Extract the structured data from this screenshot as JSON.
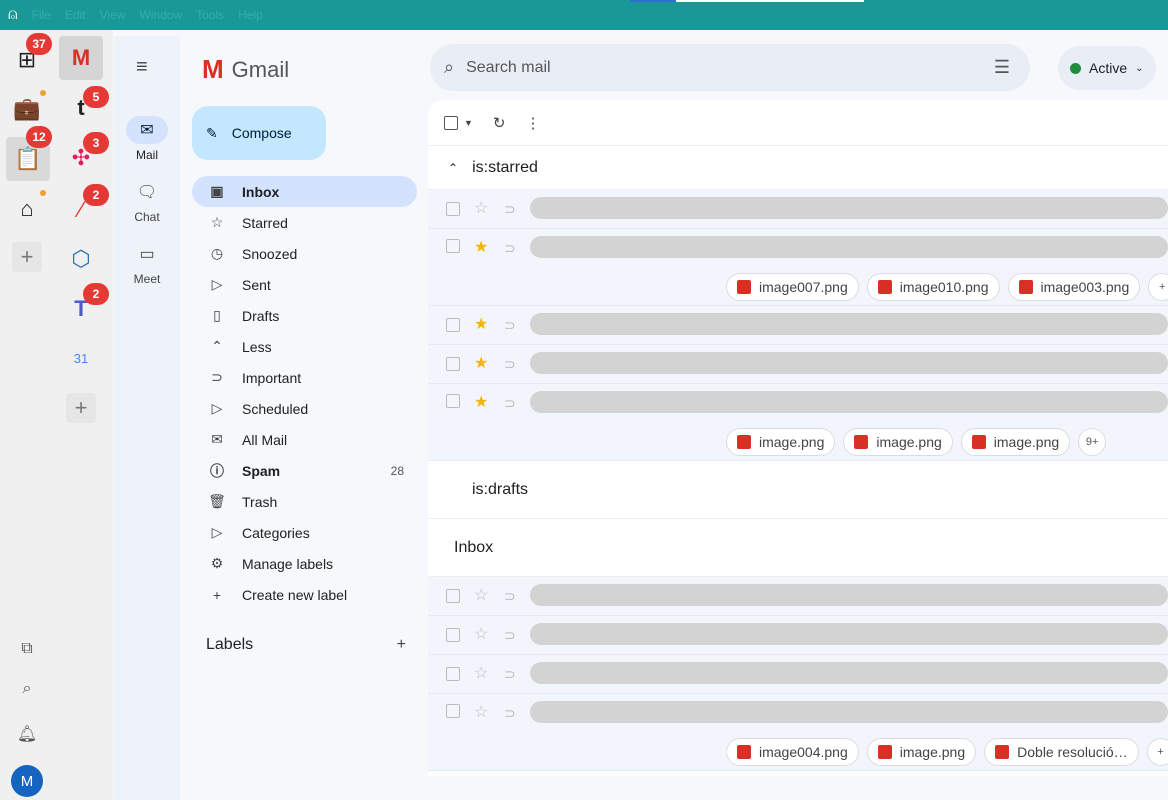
{
  "menubar": {
    "items": [
      "File",
      "Edit",
      "View",
      "Window",
      "Tools",
      "Help"
    ]
  },
  "rail": {
    "badges": {
      "dashboard": "37",
      "tasks": "12",
      "tape": "5",
      "slack": "3",
      "asana": "2",
      "teams": "2"
    },
    "calendar_day": "31",
    "avatar": "M"
  },
  "gnav": {
    "mail": "Mail",
    "chat": "Chat",
    "meet": "Meet"
  },
  "sidebar": {
    "logo": "Gmail",
    "compose": "Compose",
    "items": [
      {
        "label": "Inbox",
        "icon": "inbox-icon",
        "glyph": "▣"
      },
      {
        "label": "Starred",
        "icon": "star-icon",
        "glyph": "☆"
      },
      {
        "label": "Snoozed",
        "icon": "clock-icon",
        "glyph": "◷"
      },
      {
        "label": "Sent",
        "icon": "send-icon",
        "glyph": "▷"
      },
      {
        "label": "Drafts",
        "icon": "draft-icon",
        "glyph": "▯"
      },
      {
        "label": "Less",
        "icon": "chevron-up-icon",
        "glyph": "⌃"
      },
      {
        "label": "Important",
        "icon": "important-icon",
        "glyph": "⊃"
      },
      {
        "label": "Scheduled",
        "icon": "scheduled-icon",
        "glyph": "▷"
      },
      {
        "label": "All Mail",
        "icon": "all-mail-icon",
        "glyph": "✉"
      },
      {
        "label": "Spam",
        "icon": "spam-icon",
        "glyph": "ⓘ",
        "count": "28"
      },
      {
        "label": "Trash",
        "icon": "trash-icon",
        "glyph": "🗑"
      },
      {
        "label": "Categories",
        "icon": "label-icon",
        "glyph": "▷"
      },
      {
        "label": "Manage labels",
        "icon": "gear-icon",
        "glyph": "⚙"
      },
      {
        "label": "Create new label",
        "icon": "plus-icon",
        "glyph": "+"
      }
    ],
    "labels_heading": "Labels"
  },
  "search": {
    "placeholder": "Search mail"
  },
  "status": {
    "label": "Active",
    "color": "#1e8e3e"
  },
  "sections": {
    "starred": "is:starred",
    "drafts": "is:drafts",
    "inbox": "Inbox"
  },
  "attachments": {
    "row1": [
      "image007.png",
      "image010.png",
      "image003.png"
    ],
    "row2": [
      "image.png",
      "image.png",
      "image.png"
    ],
    "row2_more": "9+",
    "row3": [
      "image004.png",
      "image.png",
      "Doble resolució…"
    ]
  },
  "colors": {
    "accent": "#1a9797",
    "compose": "#c2e7ff",
    "selected": "#d3e3fd",
    "badge": "#e53935"
  }
}
